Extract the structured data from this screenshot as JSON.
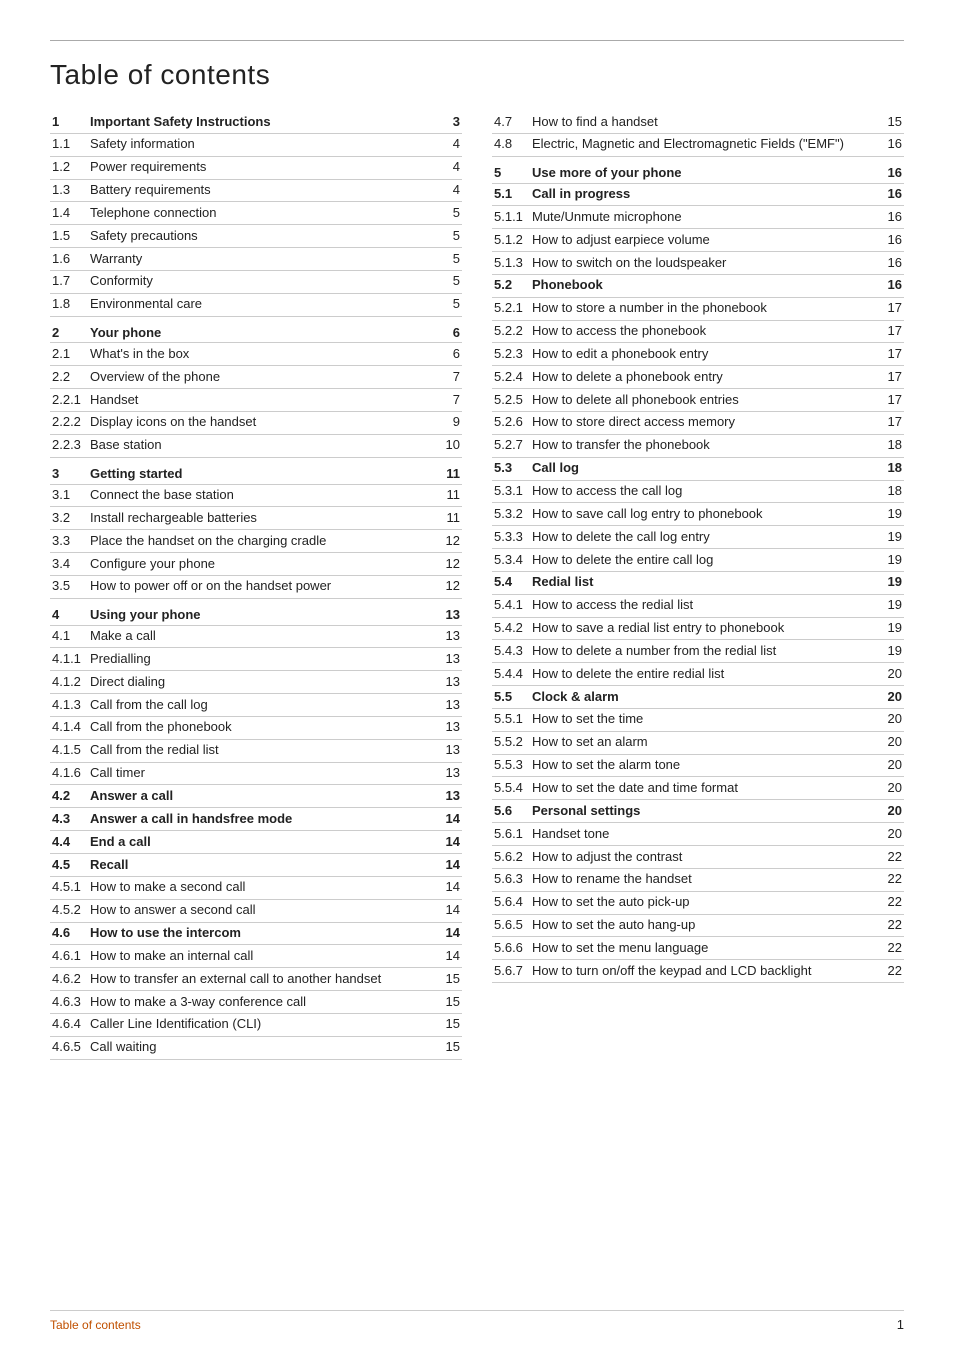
{
  "page": {
    "title": "Table of contents"
  },
  "left_col": [
    {
      "num": "1",
      "label": "Important Safety Instructions",
      "page": "3",
      "bold": true
    },
    {
      "num": "1.1",
      "label": "Safety information",
      "page": "4",
      "bold": false
    },
    {
      "num": "1.2",
      "label": "Power requirements",
      "page": "4",
      "bold": false
    },
    {
      "num": "1.3",
      "label": "Battery requirements",
      "page": "4",
      "bold": false
    },
    {
      "num": "1.4",
      "label": "Telephone connection",
      "page": "5",
      "bold": false
    },
    {
      "num": "1.5",
      "label": "Safety precautions",
      "page": "5",
      "bold": false
    },
    {
      "num": "1.6",
      "label": "Warranty",
      "page": "5",
      "bold": false
    },
    {
      "num": "1.7",
      "label": "Conformity",
      "page": "5",
      "bold": false
    },
    {
      "num": "1.8",
      "label": "Environmental care",
      "page": "5",
      "bold": false
    },
    {
      "num": "2",
      "label": "Your phone",
      "page": "6",
      "bold": true,
      "spacer": true
    },
    {
      "num": "2.1",
      "label": "What's in the box",
      "page": "6",
      "bold": false
    },
    {
      "num": "2.2",
      "label": "Overview of the phone",
      "page": "7",
      "bold": false
    },
    {
      "num": "2.2.1",
      "label": "Handset",
      "page": "7",
      "bold": false
    },
    {
      "num": "2.2.2",
      "label": "Display icons on the handset",
      "page": "9",
      "bold": false
    },
    {
      "num": "2.2.3",
      "label": "Base station",
      "page": "10",
      "bold": false
    },
    {
      "num": "3",
      "label": "Getting started",
      "page": "11",
      "bold": true,
      "spacer": true
    },
    {
      "num": "3.1",
      "label": "Connect the base station",
      "page": "11",
      "bold": false
    },
    {
      "num": "3.2",
      "label": "Install rechargeable batteries",
      "page": "11",
      "bold": false
    },
    {
      "num": "3.3",
      "label": "Place the handset on the charging cradle",
      "page": "12",
      "bold": false,
      "multiline": true
    },
    {
      "num": "3.4",
      "label": "Configure your phone",
      "page": "12",
      "bold": false
    },
    {
      "num": "3.5",
      "label": "How to power off or on the handset power",
      "page": "12",
      "bold": false,
      "multiline": true
    },
    {
      "num": "4",
      "label": "Using your phone",
      "page": "13",
      "bold": true,
      "spacer": true
    },
    {
      "num": "4.1",
      "label": "Make a call",
      "page": "13",
      "bold": false
    },
    {
      "num": "4.1.1",
      "label": "Predialling",
      "page": "13",
      "bold": false
    },
    {
      "num": "4.1.2",
      "label": "Direct dialing",
      "page": "13",
      "bold": false
    },
    {
      "num": "4.1.3",
      "label": "Call from the call log",
      "page": "13",
      "bold": false
    },
    {
      "num": "4.1.4",
      "label": "Call from the phonebook",
      "page": "13",
      "bold": false
    },
    {
      "num": "4.1.5",
      "label": "Call from the redial list",
      "page": "13",
      "bold": false
    },
    {
      "num": "4.1.6",
      "label": "Call timer",
      "page": "13",
      "bold": false
    },
    {
      "num": "4.2",
      "label": "Answer a call",
      "page": "13",
      "bold": true
    },
    {
      "num": "4.3",
      "label": "Answer a call in handsfree mode",
      "page": "14",
      "bold": true
    },
    {
      "num": "4.4",
      "label": "End a call",
      "page": "14",
      "bold": true
    },
    {
      "num": "4.5",
      "label": "Recall",
      "page": "14",
      "bold": true
    },
    {
      "num": "4.5.1",
      "label": "How to make a second call",
      "page": "14",
      "bold": false
    },
    {
      "num": "4.5.2",
      "label": "How to answer a second call",
      "page": "14",
      "bold": false
    },
    {
      "num": "4.6",
      "label": "How to use the intercom",
      "page": "14",
      "bold": true
    },
    {
      "num": "4.6.1",
      "label": "How to make an internal call",
      "page": "14",
      "bold": false
    },
    {
      "num": "4.6.2",
      "label": "How to transfer an external call to another handset",
      "page": "15",
      "bold": false,
      "multiline": true
    },
    {
      "num": "4.6.3",
      "label": "How to make a 3-way conference call",
      "page": "15",
      "bold": false
    },
    {
      "num": "4.6.4",
      "label": "Caller Line Identification (CLI)",
      "page": "15",
      "bold": false
    },
    {
      "num": "4.6.5",
      "label": "Call waiting",
      "page": "15",
      "bold": false
    }
  ],
  "right_col": [
    {
      "num": "4.7",
      "label": "How to find a handset",
      "page": "15",
      "bold": false
    },
    {
      "num": "4.8",
      "label": "Electric, Magnetic and Electromagnetic Fields (\"EMF\")",
      "page": "16",
      "bold": false,
      "multiline": true
    },
    {
      "num": "5",
      "label": "Use more of your phone",
      "page": "16",
      "bold": true,
      "spacer": true
    },
    {
      "num": "5.1",
      "label": "Call in progress",
      "page": "16",
      "bold": true
    },
    {
      "num": "5.1.1",
      "label": "Mute/Unmute microphone",
      "page": "16",
      "bold": false
    },
    {
      "num": "5.1.2",
      "label": "How to adjust earpiece volume",
      "page": "16",
      "bold": false
    },
    {
      "num": "5.1.3",
      "label": "How to switch on the loudspeaker",
      "page": "16",
      "bold": false
    },
    {
      "num": "5.2",
      "label": "Phonebook",
      "page": "16",
      "bold": true
    },
    {
      "num": "5.2.1",
      "label": "How to store a number in the phonebook",
      "page": "17",
      "bold": false,
      "multiline": true
    },
    {
      "num": "5.2.2",
      "label": "How to access the phonebook",
      "page": "17",
      "bold": false
    },
    {
      "num": "5.2.3",
      "label": "How to edit a phonebook entry",
      "page": "17",
      "bold": false
    },
    {
      "num": "5.2.4",
      "label": "How to delete a phonebook entry",
      "page": "17",
      "bold": false
    },
    {
      "num": "5.2.5",
      "label": "How to delete all phonebook entries",
      "page": "17",
      "bold": false
    },
    {
      "num": "5.2.6",
      "label": "How to store direct access memory",
      "page": "17",
      "bold": false
    },
    {
      "num": "5.2.7",
      "label": "How to transfer the phonebook",
      "page": "18",
      "bold": false
    },
    {
      "num": "5.3",
      "label": "Call log",
      "page": "18",
      "bold": true
    },
    {
      "num": "5.3.1",
      "label": "How to access the call log",
      "page": "18",
      "bold": false
    },
    {
      "num": "5.3.2",
      "label": "How to save call log entry to phonebook",
      "page": "19",
      "bold": false,
      "multiline": true
    },
    {
      "num": "5.3.3",
      "label": "How to delete the call log entry",
      "page": "19",
      "bold": false
    },
    {
      "num": "5.3.4",
      "label": "How to delete the entire call log",
      "page": "19",
      "bold": false
    },
    {
      "num": "5.4",
      "label": "Redial list",
      "page": "19",
      "bold": true
    },
    {
      "num": "5.4.1",
      "label": "How to access the redial list",
      "page": "19",
      "bold": false
    },
    {
      "num": "5.4.2",
      "label": "How to save a redial list entry to phonebook",
      "page": "19",
      "bold": false,
      "multiline": true
    },
    {
      "num": "5.4.3",
      "label": "How to delete a number from the redial list",
      "page": "19",
      "bold": false,
      "multiline": true
    },
    {
      "num": "5.4.4",
      "label": "How to delete the entire redial list",
      "page": "20",
      "bold": false
    },
    {
      "num": "5.5",
      "label": "Clock & alarm",
      "page": "20",
      "bold": true
    },
    {
      "num": "5.5.1",
      "label": "How to set the time",
      "page": "20",
      "bold": false
    },
    {
      "num": "5.5.2",
      "label": "How to set an alarm",
      "page": "20",
      "bold": false
    },
    {
      "num": "5.5.3",
      "label": "How to set the alarm tone",
      "page": "20",
      "bold": false
    },
    {
      "num": "5.5.4",
      "label": "How to set the date and time format",
      "page": "20",
      "bold": false
    },
    {
      "num": "5.6",
      "label": "Personal settings",
      "page": "20",
      "bold": true
    },
    {
      "num": "5.6.1",
      "label": "Handset tone",
      "page": "20",
      "bold": false
    },
    {
      "num": "5.6.2",
      "label": "How to adjust the contrast",
      "page": "22",
      "bold": false
    },
    {
      "num": "5.6.3",
      "label": "How to rename the handset",
      "page": "22",
      "bold": false
    },
    {
      "num": "5.6.4",
      "label": "How to set the auto pick-up",
      "page": "22",
      "bold": false
    },
    {
      "num": "5.6.5",
      "label": "How to set the auto hang-up",
      "page": "22",
      "bold": false
    },
    {
      "num": "5.6.6",
      "label": "How to set the menu language",
      "page": "22",
      "bold": false
    },
    {
      "num": "5.6.7",
      "label": "How to turn on/off the keypad and LCD backlight",
      "page": "22",
      "bold": false,
      "multiline": true
    }
  ],
  "footer": {
    "left": "Table of contents",
    "right": "1"
  }
}
